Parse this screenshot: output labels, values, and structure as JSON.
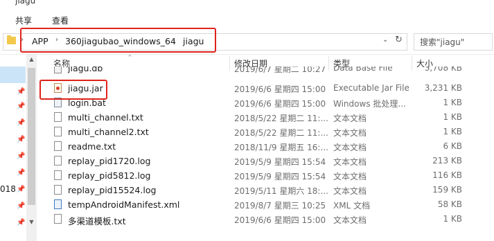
{
  "window": {
    "title": "jiagu"
  },
  "ribbon": {
    "tabs": [
      "共享",
      "查看"
    ]
  },
  "address": {
    "breadcrumbs": [
      "APP",
      "360jiagubao_windows_64",
      "jiagu"
    ],
    "separator": "›",
    "dropdown_glyph": "⌄",
    "refresh_glyph": "↻"
  },
  "search": {
    "placeholder": "搜索\"jiagu\""
  },
  "nav": {
    "partial_label": "018",
    "pin_glyph": "📌",
    "scroll_up": "▲",
    "scroll_down": "▼"
  },
  "columns": {
    "name": "名称",
    "date": "修改日期",
    "type": "类型",
    "size": "大小",
    "sort_caret": "^"
  },
  "files": [
    {
      "name": "jiagu.db",
      "date": "2019/6/7 星期二 10:27",
      "type": "Data Base File",
      "size": "3,708 KB",
      "icon": "db-file-icon"
    },
    {
      "name": "jiagu.jar",
      "date": "2019/6/6 星期四 15:00",
      "type": "Executable Jar File",
      "size": "3,231 KB",
      "icon": "jar-file-icon"
    },
    {
      "name": "login.bat",
      "date": "2019/6/6 星期四 15:00",
      "type": "Windows 批处理...",
      "size": "1 KB",
      "icon": "batch-file-icon"
    },
    {
      "name": "multi_channel.txt",
      "date": "2018/5/22 星期二 11:...",
      "type": "文本文档",
      "size": "1 KB",
      "icon": "text-file-icon"
    },
    {
      "name": "multi_channel2.txt",
      "date": "2018/5/22 星期二 11:...",
      "type": "文本文档",
      "size": "1 KB",
      "icon": "text-file-icon"
    },
    {
      "name": "readme.txt",
      "date": "2018/11/9 星期五 16:...",
      "type": "文本文档",
      "size": "6 KB",
      "icon": "text-file-icon"
    },
    {
      "name": "replay_pid1720.log",
      "date": "2019/5/9 星期四 15:54",
      "type": "文本文档",
      "size": "213 KB",
      "icon": "text-file-icon"
    },
    {
      "name": "replay_pid5812.log",
      "date": "2019/5/9 星期四 15:54",
      "type": "文本文档",
      "size": "116 KB",
      "icon": "text-file-icon"
    },
    {
      "name": "replay_pid15524.log",
      "date": "2019/5/11 星期六 18:...",
      "type": "文本文档",
      "size": "159 KB",
      "icon": "text-file-icon"
    },
    {
      "name": "tempAndroidManifest.xml",
      "date": "2019/8/7 星期三 10:25",
      "type": "XML 文档",
      "size": "58 KB",
      "icon": "xml-file-icon"
    },
    {
      "name": "多渠道模板.txt",
      "date": "2019/6/6 星期四 15:00",
      "type": "文本文档",
      "size": "1 KB",
      "icon": "text-file-icon"
    }
  ],
  "colors": {
    "highlight_box": "#e0221a",
    "nav_selection": "#cce4f7",
    "folder": "#f3c94d"
  }
}
